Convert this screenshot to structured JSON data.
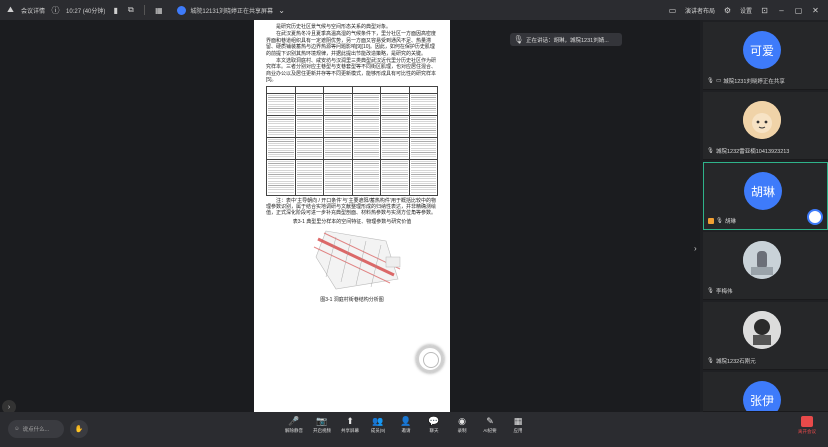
{
  "topbar": {
    "app_name": "会议详情",
    "time": "10:27 (40分钟)",
    "sharing_label": "城院12131刘晓婷正在共享屏幕",
    "layout_label": "演讲者布局",
    "settings_label": "设置"
  },
  "document": {
    "paragraphs": [
      "是研究历史社区景气候与空间形态关系的典型对象。",
      "在武汉夏热冬冷且夏季高温高湿的气候条件下，里分社区一方面因高密度界面和巷道组织具有一定遮阴优势，另一方面又容易受到通风不足、热量滞留、硬质铺装蓄热与边界热源等问题影响[9][10]。因此，如何在保护历史肌理的前提下识别其热环境规律，并据此提出节能改造策略，是研究的关键。",
      "本文选取洞庭村、咸安坊与汉润里三类典型武汉近代里分历史社区作为研究样本。三者分别对应主巷型与支巷套型等不同街区肌理，也对应居住混合、商业办公以及居住更新并存等不同更新模式，能够形成具有可比性的研究样本[5]。"
    ],
    "table_note": "注：表中‘主导朝向 / 开口条件’与‘主要遮阳/蓄热构件’用于概括比较中的物理参数识别，属于结合实地调研与文献整理形成的归纳性表达，并非精确测绘值，正式深化阶段可进一步补充典型剖面、材料热参数与实测方位角等参数。",
    "table_caption": "表3-1 典型里分样本的空间特征、物理参数与研究价值",
    "figure_caption": "图3-1 洞庭村街巷结构分析图"
  },
  "toast": {
    "text": "正在讲话：胡琳，城院1231刘婧..."
  },
  "participants": [
    {
      "avatar_text": "可爱",
      "name": "城院1231刘晓婷正在共享",
      "color": "#3e7bfa"
    },
    {
      "avatar_text": "",
      "name": "城院1232雷亚楠10413923213",
      "color": "#e8c79a"
    },
    {
      "avatar_text": "胡琳",
      "name": "胡琳",
      "color": "#3e7bfa"
    },
    {
      "avatar_text": "",
      "name": "李梅伟",
      "color": "#b9c4cc"
    },
    {
      "avatar_text": "",
      "name": "城院1232石刚元",
      "color": "#cfcfcf"
    },
    {
      "avatar_text": "张伊",
      "name": "",
      "color": "#3e7bfa"
    }
  ],
  "bottombar": {
    "chat_placeholder": "说点什么...",
    "tools": [
      {
        "label": "解除静音",
        "icon": "mic-off-icon"
      },
      {
        "label": "开启视频",
        "icon": "camera-off-icon"
      },
      {
        "label": "共享屏幕",
        "icon": "share-screen-icon"
      },
      {
        "label": "成员(9)",
        "icon": "members-icon"
      },
      {
        "label": "邀请",
        "icon": "invite-icon"
      },
      {
        "label": "聊天",
        "icon": "chat-icon"
      },
      {
        "label": "录制",
        "icon": "record-icon"
      },
      {
        "label": "AI纪要",
        "icon": "ai-notes-icon"
      },
      {
        "label": "应用",
        "icon": "apps-icon"
      }
    ],
    "end_label": "离开会议"
  }
}
